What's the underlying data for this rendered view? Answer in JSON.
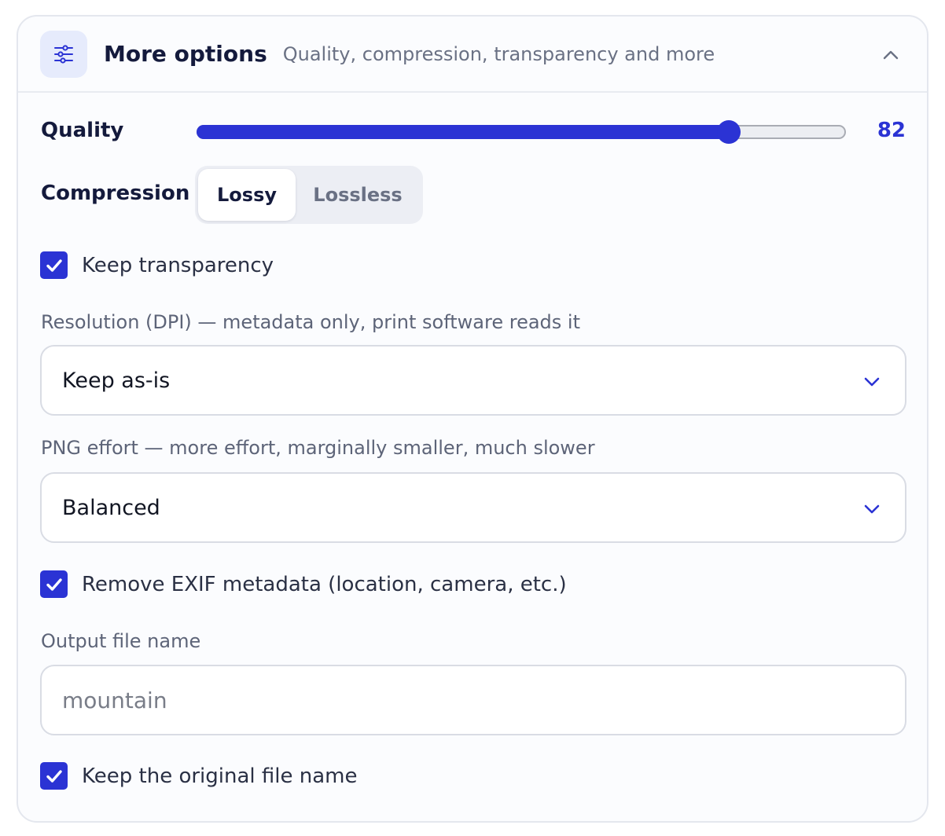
{
  "header": {
    "icon": "sliders-icon",
    "title": "More options",
    "subtitle": "Quality, compression, transparency and more",
    "collapse_icon": "chevron-up-icon"
  },
  "quality": {
    "label": "Quality",
    "value": 82,
    "min": 0,
    "max": 100,
    "value_text": "82"
  },
  "compression": {
    "label": "Compression",
    "options": [
      "Lossy",
      "Lossless"
    ],
    "selected": "Lossy"
  },
  "keep_transparency": {
    "label": "Keep transparency",
    "checked": true
  },
  "resolution": {
    "label": "Resolution (DPI) — metadata only, print software reads it",
    "value": "Keep as-is",
    "icon": "chevron-down-icon"
  },
  "png_effort": {
    "label": "PNG effort — more effort, marginally smaller, much slower",
    "value": "Balanced",
    "icon": "chevron-down-icon"
  },
  "remove_exif": {
    "label": "Remove EXIF metadata (location, camera, etc.)",
    "checked": true
  },
  "output_name": {
    "label": "Output file name",
    "placeholder": "mountain",
    "value": ""
  },
  "keep_original_name": {
    "label": "Keep the original file name",
    "checked": true
  },
  "colors": {
    "accent": "#2b33d4",
    "title": "#141a3c",
    "muted": "#6a7184",
    "icon_bg": "#e6ebfc"
  }
}
